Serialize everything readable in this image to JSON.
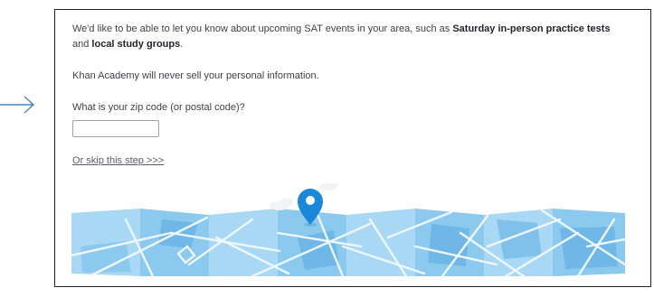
{
  "intro": {
    "text_before": "We'd like to be able to let you know about upcoming SAT events in your area, such as ",
    "bold_1": "Saturday in-person practice tests",
    "text_middle": " and ",
    "bold_2": "local study groups",
    "text_after": "."
  },
  "privacy_note": "Khan Academy will never sell your personal information.",
  "zip": {
    "label": "What is your zip code (or postal code)?",
    "value": "",
    "placeholder": ""
  },
  "skip_link": "Or skip this step >>>",
  "colors": {
    "pin": "#1a87d8",
    "map_light": "#a8d8f3",
    "map_mid": "#8cc9ee",
    "map_dark": "#6fb7e6",
    "road": "#eef7fc",
    "arrow": "#4f81bd"
  },
  "icons": {
    "pointer_arrow": "arrow-right-icon",
    "map_pin": "map-pin-icon"
  }
}
